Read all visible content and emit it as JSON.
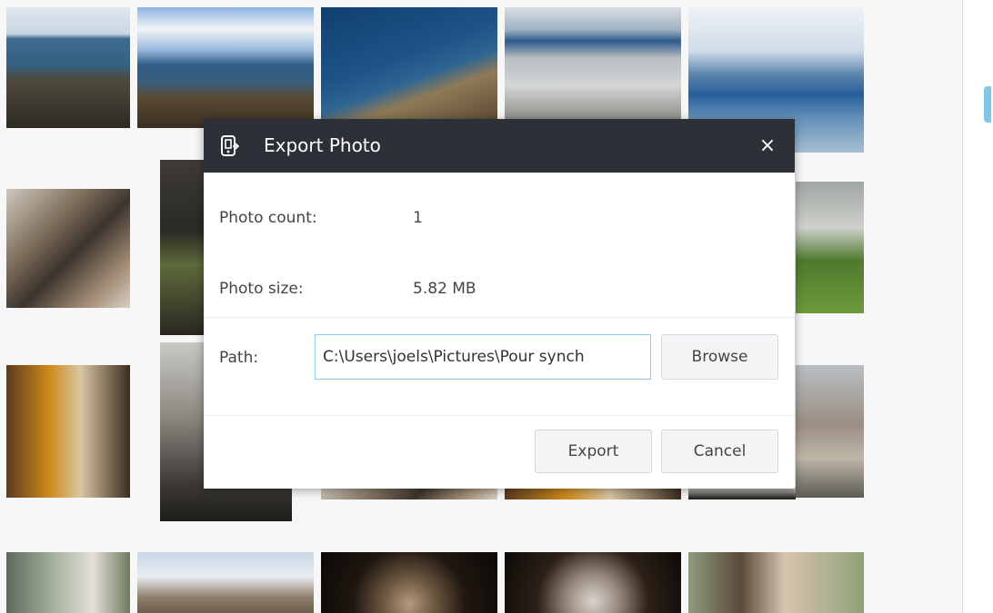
{
  "dialog": {
    "title": "Export Photo",
    "close_glyph": "×",
    "header_icon": "phone-export-icon",
    "photo_count_label": "Photo count:",
    "photo_count_value": "1",
    "photo_size_label": "Photo size:",
    "photo_size_value": "5.82 MB",
    "path_label": "Path:",
    "path_value": "C:\\Users\\joels\\Pictures\\Pour synch",
    "browse_label": "Browse",
    "export_label": "Export",
    "cancel_label": "Cancel"
  },
  "colors": {
    "header_bg": "#2d3036",
    "input_border": "#8fc8ea",
    "button_bg": "#f3f5f7"
  }
}
